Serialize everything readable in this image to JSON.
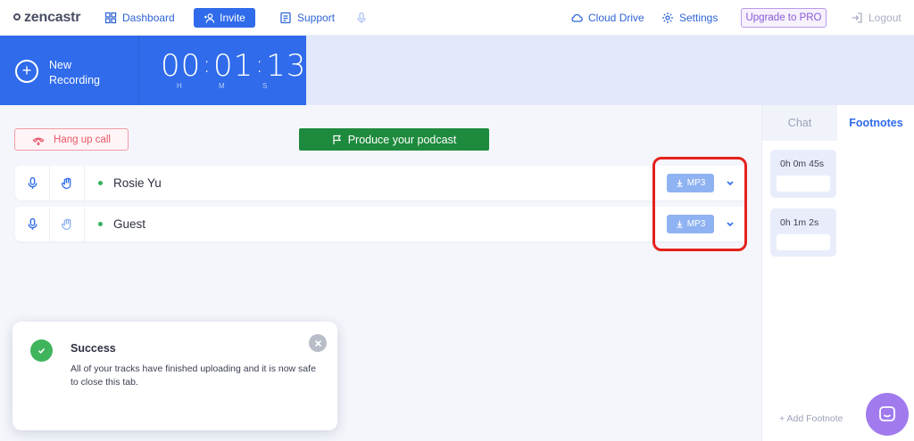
{
  "app": {
    "logo_text": "zencastr"
  },
  "topnav": {
    "dashboard": "Dashboard",
    "invite": "Invite",
    "support": "Support",
    "cloud_drive": "Cloud Drive",
    "settings": "Settings",
    "upgrade": "Upgrade to PRO",
    "logout": "Logout"
  },
  "recording": {
    "new_line1": "New",
    "new_line2": "Recording",
    "hours": "00",
    "minutes": "01",
    "seconds": "13",
    "unit_h": "H",
    "unit_m": "M",
    "unit_s": "S"
  },
  "controls": {
    "hangup": "Hang up call",
    "produce": "Produce your podcast"
  },
  "participants": [
    {
      "name": "Rosie Yu",
      "download_label": "MP3"
    },
    {
      "name": "Guest",
      "download_label": "MP3"
    }
  ],
  "sidebar": {
    "tabs": [
      "Chat",
      "Footnotes"
    ],
    "active_tab": "Footnotes",
    "footnotes": [
      {
        "time": "0h 0m 45s"
      },
      {
        "time": "0h 1m 2s"
      }
    ],
    "add_footnote": "+ Add Footnote"
  },
  "toast": {
    "title": "Success",
    "message": "All of your tracks have finished uploading and it is now safe to close this tab."
  },
  "colors": {
    "primary": "#2f6bea",
    "success": "#3fb45d",
    "produce": "#1e8a3d",
    "danger": "#e8596a",
    "highlight": "#e4211c",
    "upgrade": "#8a5ad6"
  },
  "icons": [
    "dashboard-icon",
    "invite-person-icon",
    "support-icon",
    "mic-icon",
    "cloud-icon",
    "settings-gear-icon",
    "logout-icon",
    "plus-circle-icon",
    "hangup-phone-icon",
    "flag-icon",
    "hand-icon",
    "download-icon",
    "chevron-down-icon",
    "check-icon",
    "close-icon",
    "chat-bubble-icon"
  ]
}
